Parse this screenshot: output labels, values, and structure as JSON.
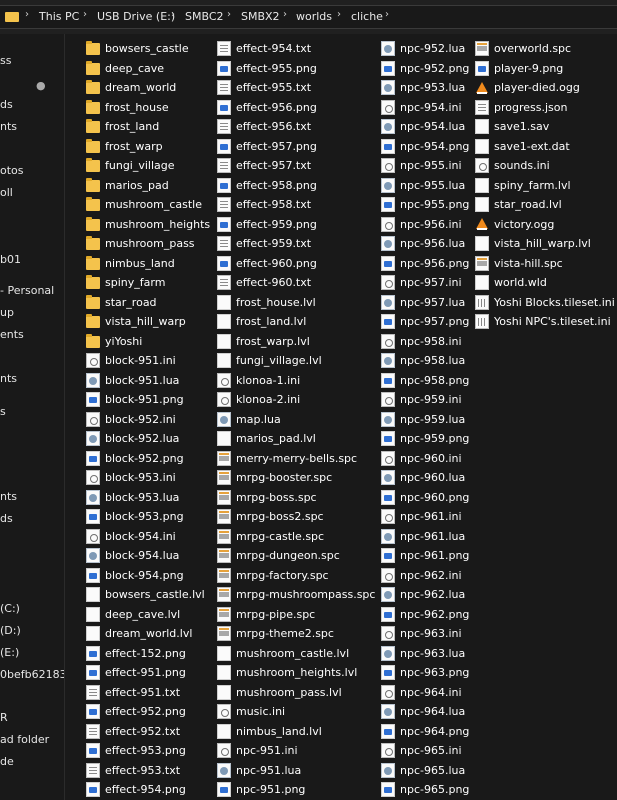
{
  "breadcrumb": {
    "items": [
      "This PC",
      "USB Drive (E:)",
      "SMBC2",
      "SMBX2",
      "worlds",
      "cliche"
    ]
  },
  "nav": {
    "items": [
      "ss",
      "ds",
      "nts",
      "",
      "otos",
      "oll",
      "",
      "b01",
      "- Personal",
      "up",
      "ents",
      "nts",
      "s",
      "nts",
      "ds",
      "(C:)",
      "(D:)",
      "(E:)",
      "0befb62183",
      "R",
      "ad folder",
      "de"
    ]
  },
  "columns": [
    [
      {
        "n": "bowsers_castle",
        "t": "folder"
      },
      {
        "n": "deep_cave",
        "t": "folder"
      },
      {
        "n": "dream_world",
        "t": "folder"
      },
      {
        "n": "frost_house",
        "t": "folder"
      },
      {
        "n": "frost_land",
        "t": "folder"
      },
      {
        "n": "frost_warp",
        "t": "folder"
      },
      {
        "n": "fungi_village",
        "t": "folder"
      },
      {
        "n": "marios_pad",
        "t": "folder"
      },
      {
        "n": "mushroom_castle",
        "t": "folder"
      },
      {
        "n": "mushroom_heights",
        "t": "folder"
      },
      {
        "n": "mushroom_pass",
        "t": "folder"
      },
      {
        "n": "nimbus_land",
        "t": "folder"
      },
      {
        "n": "spiny_farm",
        "t": "folder"
      },
      {
        "n": "star_road",
        "t": "folder"
      },
      {
        "n": "vista_hill_warp",
        "t": "folder"
      },
      {
        "n": "yiYoshi",
        "t": "folder"
      },
      {
        "n": "block-951.ini",
        "t": "ini"
      },
      {
        "n": "block-951.lua",
        "t": "lua"
      },
      {
        "n": "block-951.png",
        "t": "png"
      },
      {
        "n": "block-952.ini",
        "t": "ini"
      },
      {
        "n": "block-952.lua",
        "t": "lua"
      },
      {
        "n": "block-952.png",
        "t": "png"
      },
      {
        "n": "block-953.ini",
        "t": "ini"
      },
      {
        "n": "block-953.lua",
        "t": "lua"
      },
      {
        "n": "block-953.png",
        "t": "png"
      },
      {
        "n": "block-954.ini",
        "t": "ini"
      },
      {
        "n": "block-954.lua",
        "t": "lua"
      },
      {
        "n": "block-954.png",
        "t": "png"
      },
      {
        "n": "bowsers_castle.lvl",
        "t": "doc"
      },
      {
        "n": "deep_cave.lvl",
        "t": "doc"
      },
      {
        "n": "dream_world.lvl",
        "t": "doc"
      },
      {
        "n": "effect-152.png",
        "t": "png"
      },
      {
        "n": "effect-951.png",
        "t": "png"
      },
      {
        "n": "effect-951.txt",
        "t": "txt"
      },
      {
        "n": "effect-952.png",
        "t": "png"
      },
      {
        "n": "effect-952.txt",
        "t": "txt"
      },
      {
        "n": "effect-953.png",
        "t": "png"
      },
      {
        "n": "effect-953.txt",
        "t": "txt"
      },
      {
        "n": "effect-954.png",
        "t": "png"
      }
    ],
    [
      {
        "n": "effect-954.txt",
        "t": "txt"
      },
      {
        "n": "effect-955.png",
        "t": "png"
      },
      {
        "n": "effect-955.txt",
        "t": "txt"
      },
      {
        "n": "effect-956.png",
        "t": "png"
      },
      {
        "n": "effect-956.txt",
        "t": "txt"
      },
      {
        "n": "effect-957.png",
        "t": "png"
      },
      {
        "n": "effect-957.txt",
        "t": "txt"
      },
      {
        "n": "effect-958.png",
        "t": "png"
      },
      {
        "n": "effect-958.txt",
        "t": "txt"
      },
      {
        "n": "effect-959.png",
        "t": "png"
      },
      {
        "n": "effect-959.txt",
        "t": "txt"
      },
      {
        "n": "effect-960.png",
        "t": "png"
      },
      {
        "n": "effect-960.txt",
        "t": "txt"
      },
      {
        "n": "frost_house.lvl",
        "t": "doc"
      },
      {
        "n": "frost_land.lvl",
        "t": "doc"
      },
      {
        "n": "frost_warp.lvl",
        "t": "doc"
      },
      {
        "n": "fungi_village.lvl",
        "t": "doc"
      },
      {
        "n": "klonoa-1.ini",
        "t": "ini"
      },
      {
        "n": "klonoa-2.ini",
        "t": "ini"
      },
      {
        "n": "map.lua",
        "t": "lua"
      },
      {
        "n": "marios_pad.lvl",
        "t": "doc"
      },
      {
        "n": "merry-merry-bells.spc",
        "t": "spc"
      },
      {
        "n": "mrpg-booster.spc",
        "t": "spc"
      },
      {
        "n": "mrpg-boss.spc",
        "t": "spc"
      },
      {
        "n": "mrpg-boss2.spc",
        "t": "spc"
      },
      {
        "n": "mrpg-castle.spc",
        "t": "spc"
      },
      {
        "n": "mrpg-dungeon.spc",
        "t": "spc"
      },
      {
        "n": "mrpg-factory.spc",
        "t": "spc"
      },
      {
        "n": "mrpg-mushroompass.spc",
        "t": "spc"
      },
      {
        "n": "mrpg-pipe.spc",
        "t": "spc"
      },
      {
        "n": "mrpg-theme2.spc",
        "t": "spc"
      },
      {
        "n": "mushroom_castle.lvl",
        "t": "doc"
      },
      {
        "n": "mushroom_heights.lvl",
        "t": "doc"
      },
      {
        "n": "mushroom_pass.lvl",
        "t": "doc"
      },
      {
        "n": "music.ini",
        "t": "ini"
      },
      {
        "n": "nimbus_land.lvl",
        "t": "doc"
      },
      {
        "n": "npc-951.ini",
        "t": "ini"
      },
      {
        "n": "npc-951.lua",
        "t": "lua"
      },
      {
        "n": "npc-951.png",
        "t": "png"
      }
    ],
    [
      {
        "n": "npc-952.lua",
        "t": "lua"
      },
      {
        "n": "npc-952.png",
        "t": "png"
      },
      {
        "n": "npc-953.lua",
        "t": "lua"
      },
      {
        "n": "npc-954.ini",
        "t": "ini"
      },
      {
        "n": "npc-954.lua",
        "t": "lua"
      },
      {
        "n": "npc-954.png",
        "t": "png"
      },
      {
        "n": "npc-955.ini",
        "t": "ini"
      },
      {
        "n": "npc-955.lua",
        "t": "lua"
      },
      {
        "n": "npc-955.png",
        "t": "png"
      },
      {
        "n": "npc-956.ini",
        "t": "ini"
      },
      {
        "n": "npc-956.lua",
        "t": "lua"
      },
      {
        "n": "npc-956.png",
        "t": "png"
      },
      {
        "n": "npc-957.ini",
        "t": "ini"
      },
      {
        "n": "npc-957.lua",
        "t": "lua"
      },
      {
        "n": "npc-957.png",
        "t": "png"
      },
      {
        "n": "npc-958.ini",
        "t": "ini"
      },
      {
        "n": "npc-958.lua",
        "t": "lua"
      },
      {
        "n": "npc-958.png",
        "t": "png"
      },
      {
        "n": "npc-959.ini",
        "t": "ini"
      },
      {
        "n": "npc-959.lua",
        "t": "lua"
      },
      {
        "n": "npc-959.png",
        "t": "png"
      },
      {
        "n": "npc-960.ini",
        "t": "ini"
      },
      {
        "n": "npc-960.lua",
        "t": "lua"
      },
      {
        "n": "npc-960.png",
        "t": "png"
      },
      {
        "n": "npc-961.ini",
        "t": "ini"
      },
      {
        "n": "npc-961.lua",
        "t": "lua"
      },
      {
        "n": "npc-961.png",
        "t": "png"
      },
      {
        "n": "npc-962.ini",
        "t": "ini"
      },
      {
        "n": "npc-962.lua",
        "t": "lua"
      },
      {
        "n": "npc-962.png",
        "t": "png"
      },
      {
        "n": "npc-963.ini",
        "t": "ini"
      },
      {
        "n": "npc-963.lua",
        "t": "lua"
      },
      {
        "n": "npc-963.png",
        "t": "png"
      },
      {
        "n": "npc-964.ini",
        "t": "ini"
      },
      {
        "n": "npc-964.lua",
        "t": "lua"
      },
      {
        "n": "npc-964.png",
        "t": "png"
      },
      {
        "n": "npc-965.ini",
        "t": "ini"
      },
      {
        "n": "npc-965.lua",
        "t": "lua"
      },
      {
        "n": "npc-965.png",
        "t": "png"
      }
    ],
    [
      {
        "n": "overworld.spc",
        "t": "spc"
      },
      {
        "n": "player-9.png",
        "t": "png"
      },
      {
        "n": "player-died.ogg",
        "t": "ogg"
      },
      {
        "n": "progress.json",
        "t": "txt"
      },
      {
        "n": "save1.sav",
        "t": "doc"
      },
      {
        "n": "save1-ext.dat",
        "t": "doc"
      },
      {
        "n": "sounds.ini",
        "t": "ini"
      },
      {
        "n": "spiny_farm.lvl",
        "t": "doc"
      },
      {
        "n": "star_road.lvl",
        "t": "doc"
      },
      {
        "n": "victory.ogg",
        "t": "ogg"
      },
      {
        "n": "vista_hill_warp.lvl",
        "t": "doc"
      },
      {
        "n": "vista-hill.spc",
        "t": "spc"
      },
      {
        "n": "world.wld",
        "t": "doc"
      },
      {
        "n": "Yoshi Blocks.tileset.ini",
        "t": "tileset"
      },
      {
        "n": "Yoshi NPC's.tileset.ini",
        "t": "tileset"
      }
    ]
  ]
}
